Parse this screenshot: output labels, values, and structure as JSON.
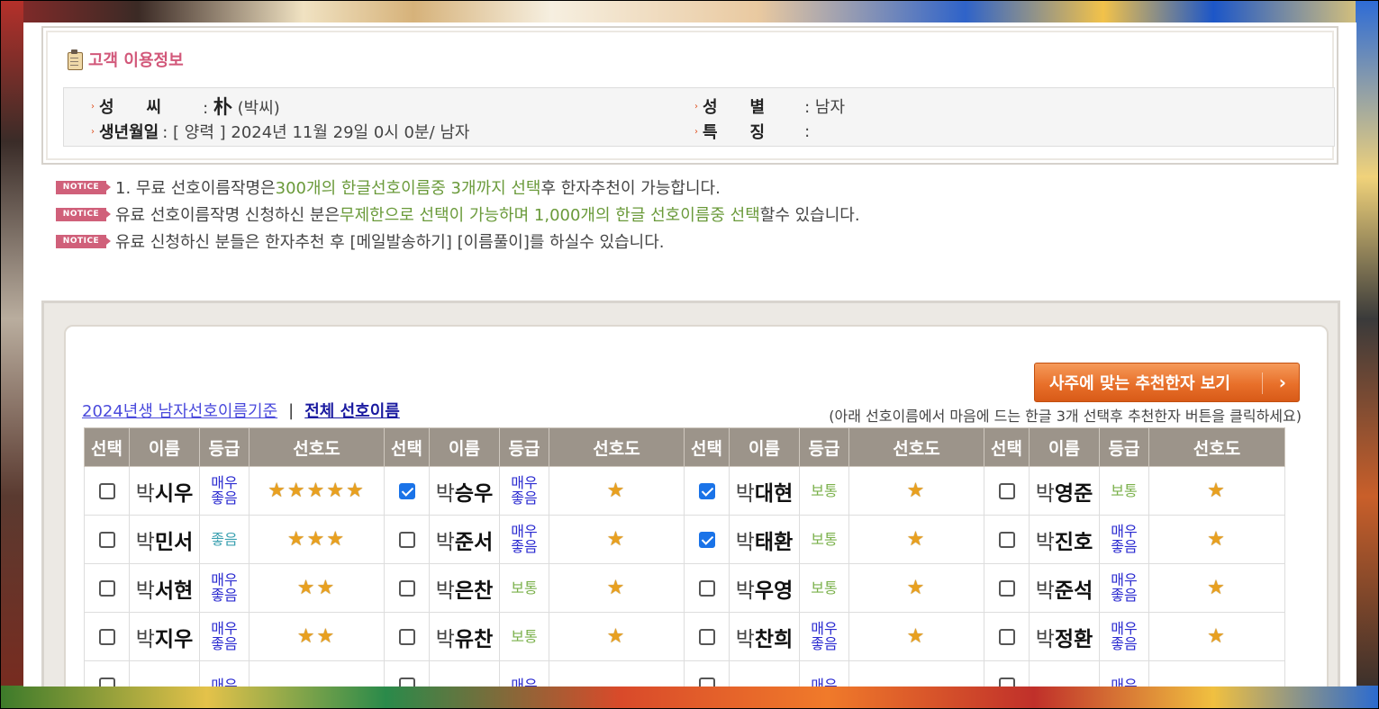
{
  "info": {
    "title": "고객 이용정보",
    "surname_label": "성　　씨",
    "surname_hanja": "朴",
    "surname_reading": "(박씨)",
    "birth_label": "생년월일",
    "birth_value": ": [ 양력 ] 2024년 11월 29일 0시 0분/ 남자",
    "gender_label": "성　　별",
    "gender_value": ": 남자",
    "feature_label": "특　　징",
    "feature_value": ":"
  },
  "notices": {
    "badge": "NOTICE",
    "n1": {
      "a": "1. 무료 선호이름작명은 ",
      "b": "300개의 한글선호이름중 3개까지 선택",
      "c": "후 한자추천이 가능합니다."
    },
    "n2": {
      "a": "유료 선호이름작명 신청하신 분은",
      "b": "무제한으로 선택이 가능하며 1,000개의 한글 선호이름중 선택",
      "c": "할수 있습니다."
    },
    "n3": {
      "a": "유료 신청하신 분들은 한자추천 후 [메일발송하기] [이름풀이]를 하실수 있습니다."
    }
  },
  "panel": {
    "recommend_button": "사주에 맞는 추천한자 보기",
    "link_current": "2024년생 남자선호이름기준",
    "link_separator": "|",
    "link_all": "전체 선호이름",
    "guide": "(아래 선호이름에서 마음에 드는 한글 3개 선택후 추천한자 버튼을 클릭하세요)"
  },
  "table": {
    "headers": [
      "선택",
      "이름",
      "등급",
      "선호도"
    ],
    "rows": [
      [
        {
          "surname": "박",
          "given": "시우",
          "grade": "매우\n좋음",
          "stars": "★★★★★",
          "checked": false
        },
        {
          "surname": "박",
          "given": "승우",
          "grade": "매우\n좋음",
          "stars": "★",
          "checked": true
        },
        {
          "surname": "박",
          "given": "대현",
          "grade": "보통",
          "stars": "★",
          "checked": true
        },
        {
          "surname": "박",
          "given": "영준",
          "grade": "보통",
          "stars": "★",
          "checked": false
        }
      ],
      [
        {
          "surname": "박",
          "given": "민서",
          "grade": "좋음",
          "stars": "★★★",
          "checked": false
        },
        {
          "surname": "박",
          "given": "준서",
          "grade": "매우\n좋음",
          "stars": "★",
          "checked": false
        },
        {
          "surname": "박",
          "given": "태환",
          "grade": "보통",
          "stars": "★",
          "checked": true
        },
        {
          "surname": "박",
          "given": "진호",
          "grade": "매우\n좋음",
          "stars": "★",
          "checked": false
        }
      ],
      [
        {
          "surname": "박",
          "given": "서현",
          "grade": "매우\n좋음",
          "stars": "★★",
          "checked": false
        },
        {
          "surname": "박",
          "given": "은찬",
          "grade": "보통",
          "stars": "★",
          "checked": false
        },
        {
          "surname": "박",
          "given": "우영",
          "grade": "보통",
          "stars": "★",
          "checked": false
        },
        {
          "surname": "박",
          "given": "준석",
          "grade": "매우\n좋음",
          "stars": "★",
          "checked": false
        }
      ],
      [
        {
          "surname": "박",
          "given": "지우",
          "grade": "매우\n좋음",
          "stars": "★★",
          "checked": false
        },
        {
          "surname": "박",
          "given": "유찬",
          "grade": "보통",
          "stars": "★",
          "checked": false
        },
        {
          "surname": "박",
          "given": "찬희",
          "grade": "매우\n좋음",
          "stars": "★",
          "checked": false
        },
        {
          "surname": "박",
          "given": "정환",
          "grade": "매우\n좋음",
          "stars": "★",
          "checked": false
        }
      ]
    ],
    "partial_row": [
      {
        "grade": "매우"
      },
      {
        "grade": "매우"
      },
      {
        "grade": "매우"
      },
      {
        "grade": "매우"
      }
    ]
  },
  "colors": {
    "accent_pink": "#d2587a",
    "highlight_green": "#6a9a3a",
    "header_gray": "#9c948a",
    "button_orange": "#e8702a",
    "grade_very_good": "#2a2ad0",
    "grade_good": "#3aa0b0",
    "grade_normal": "#7ab04a"
  }
}
